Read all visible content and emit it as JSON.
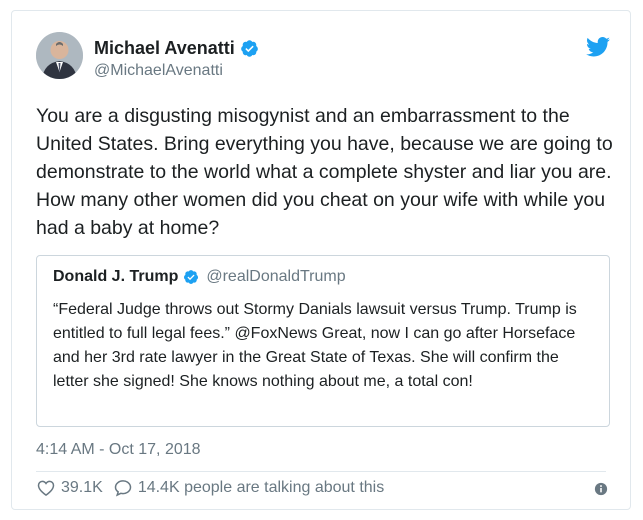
{
  "author": {
    "name": "Michael Avenatti",
    "handle": "@MichaelAvenatti"
  },
  "tweet": {
    "text": "You are a disgusting misogynist and an embarrassment to the United States. Bring everything you have, because we are going to demonstrate to the world what a complete shyster and liar you are. How many other women did you cheat on your wife with while you had a baby at home?",
    "timestamp": "4:14 AM - Oct 17, 2018"
  },
  "quoted": {
    "name": "Donald J. Trump",
    "handle": "@realDonaldTrump",
    "text": "“Federal Judge throws out Stormy Danials lawsuit versus Trump. Trump is entitled to full legal fees.” @FoxNews Great, now I can go after Horseface and her 3rd rate lawyer in the Great State of Texas. She will confirm the letter she signed! She knows nothing about me, a total con!"
  },
  "engagement": {
    "likes": "39.1K",
    "talking": "14.4K people are talking about this"
  },
  "icons": {
    "verified": "verified-badge-icon",
    "bird": "twitter-bird-icon",
    "heart": "heart-icon",
    "comment": "comment-bubble-icon",
    "info": "info-icon"
  },
  "colors": {
    "twitter_blue": "#1da1f2",
    "secondary_text": "#697882",
    "border": "#e1e8ed"
  }
}
